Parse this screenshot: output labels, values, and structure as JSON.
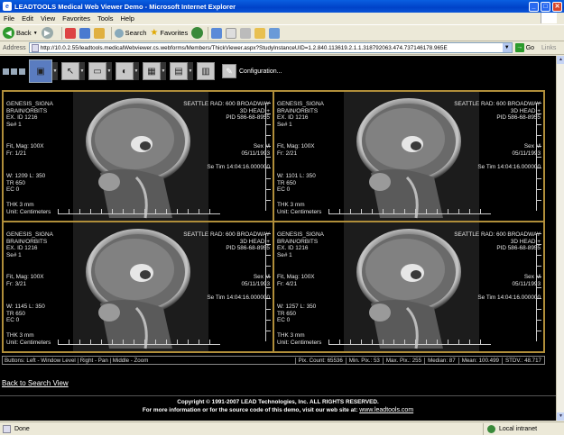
{
  "window": {
    "title": "LEADTOOLS Medical Web Viewer Demo - Microsoft Internet Explorer",
    "min_symbol": "_",
    "max_symbol": "□",
    "close_symbol": "✕"
  },
  "menu": [
    "File",
    "Edit",
    "View",
    "Favorites",
    "Tools",
    "Help"
  ],
  "toolbar": {
    "back_label": "Back",
    "search_label": "Search",
    "favorites_label": "Favorites"
  },
  "address": {
    "label": "Address",
    "url": "http://10.0.2.55/leadtools.medicalWebviewer.cs.webforms/Members/ThickViewer.aspx?StudyInstanceUID=1.2.840.113619.2.1.1.318792063.474.737146178.965E",
    "go_label": "Go",
    "links_label": "Links"
  },
  "viewer": {
    "configuration_label": "Configuration...",
    "cells": [
      {
        "patient": "GENESIS_SIGNA",
        "study": "BRAIN/ORBITS",
        "ex_id": "EX. ID 1216",
        "series": "Se# 1",
        "institution": "SEATTLE RAD: 600 BROADWAY",
        "description": "3D HEAD +",
        "pid": "PID 586-68-8955",
        "sex": "Sex M",
        "date": "05/11/1993",
        "time": "Se Tim 14:04:16.000000",
        "fit": "Fit, Mag: 100X",
        "frame": "Fr: 1/21",
        "wl": "W: 1209 L: 350",
        "tr": "TR 650",
        "ec": "EC 0",
        "thk": "THK 3 mm",
        "unit": "Unit: Centimeters"
      },
      {
        "patient": "GENESIS_SIGNA",
        "study": "BRAIN/ORBITS",
        "ex_id": "EX. ID 1216",
        "series": "Se# 1",
        "institution": "SEATTLE RAD: 600 BROADWAY",
        "description": "3D HEAD +",
        "pid": "PID 586-68-8955",
        "sex": "Sex M",
        "date": "05/11/1993",
        "time": "Se Tim 14:04:16.000000",
        "fit": "Fit, Mag: 100X",
        "frame": "Fr: 2/21",
        "wl": "W: 1101 L: 350",
        "tr": "TR 650",
        "ec": "EC 0",
        "thk": "THK 3 mm",
        "unit": "Unit: Centimeters"
      },
      {
        "patient": "GENESIS_SIGNA",
        "study": "BRAIN/ORBITS",
        "ex_id": "EX. ID 1216",
        "series": "Se# 1",
        "institution": "SEATTLE RAD: 600 BROADWAY",
        "description": "3D HEAD +",
        "pid": "PID 586-68-8955",
        "sex": "Sex M",
        "date": "05/11/1993",
        "time": "Se Tim 14:04:16.000000",
        "fit": "Fit, Mag: 100X",
        "frame": "Fr: 3/21",
        "wl": "W: 1145 L: 350",
        "tr": "TR 650",
        "ec": "EC 0",
        "thk": "THK 3 mm",
        "unit": "Unit: Centimeters"
      },
      {
        "patient": "GENESIS_SIGNA",
        "study": "BRAIN/ORBITS",
        "ex_id": "EX. ID 1216",
        "series": "Se# 1",
        "institution": "SEATTLE RAD: 600 BROADWAY",
        "description": "3D HEAD +",
        "pid": "PID 586-68-8955",
        "sex": "Sex M",
        "date": "05/11/1993",
        "time": "Se Tim 14:04:16.000000",
        "fit": "Fit, Mag: 100X",
        "frame": "Fr: 4/21",
        "wl": "W: 1257 L: 350",
        "tr": "TR 650",
        "ec": "EC 0",
        "thk": "THK 3 mm",
        "unit": "Unit: Centimeters"
      }
    ],
    "info": {
      "hint": "Buttons:  Left - Window Level  |  Right - Pan  |  Middle - Zoom",
      "pix_count": "Pix. Count: 65536",
      "min_pix": "Min. Pix.: 53",
      "max_pix": "Max. Pix.: 255",
      "median": "Median: 87",
      "mean": "Mean: 100.499",
      "stdv": "STDV.: 48.717"
    },
    "back_link": "Back to Search View",
    "copyright": "Copyright © 1991-2007 LEAD Technologies, Inc. ALL RIGHTS RESERVED.",
    "more_info": "For more information or for the source code of this demo, visit our web site at:",
    "website": "www.leadtools.com"
  },
  "status": {
    "done": "Done",
    "zone": "Local intranet"
  }
}
